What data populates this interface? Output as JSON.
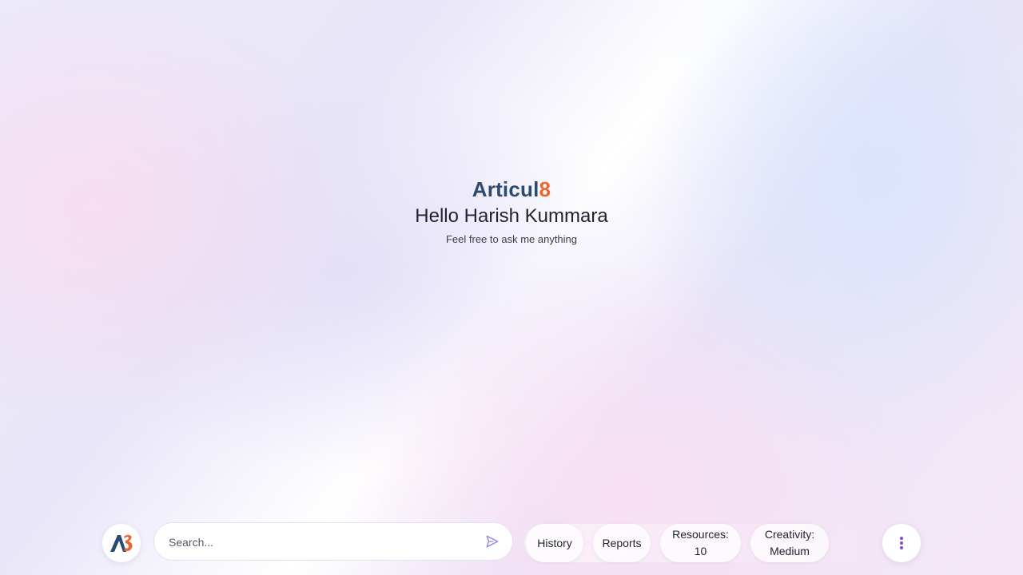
{
  "hero": {
    "logo_main": "Articul",
    "logo_accent": "8",
    "greeting": "Hello Harish Kummara",
    "subtitle": "Feel free to ask me anything"
  },
  "bottom_bar": {
    "avatar_logo_text": "A8",
    "search": {
      "placeholder": "Search...",
      "value": ""
    },
    "chips": {
      "history": "History",
      "reports": "Reports",
      "resources_label": "Resources:",
      "resources_value": "10",
      "creativity_label": "Creativity:",
      "creativity_value": "Medium"
    },
    "send_icon": "send-icon",
    "more_icon": "more-vertical-icon"
  },
  "colors": {
    "brand_navy": "#2a4a6e",
    "brand_orange": "#e9672f",
    "send_icon": "#8f86e0",
    "more_icon": "#7a52d6"
  }
}
